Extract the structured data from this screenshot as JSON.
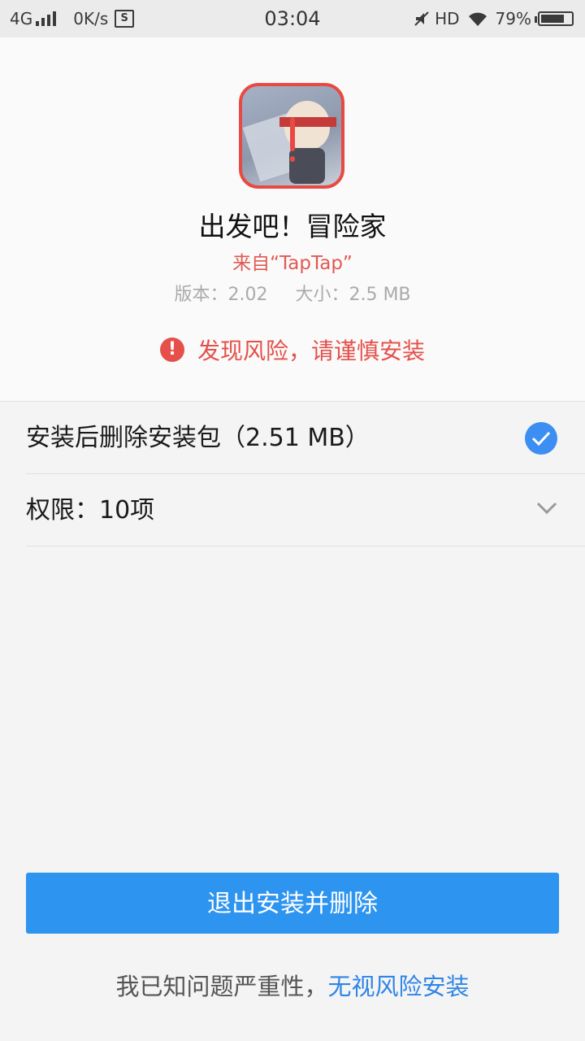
{
  "status_bar": {
    "network": "4G",
    "speed": "0K/s",
    "storage_badge": "S",
    "time": "03:04",
    "hd": "HD",
    "battery": "79%",
    "battery_level": 0.79
  },
  "app": {
    "name": "出发吧！冒险家",
    "source": "来自“TapTap”",
    "version": "版本：2.02",
    "size": "大小：2.5 MB",
    "risk_warning": "发现风险，请谨慎安装"
  },
  "options": {
    "delete_after_install": "安装后删除安装包（2.51 MB）",
    "delete_checked": true,
    "permissions": "权限：10项"
  },
  "actions": {
    "exit_button": "退出安装并删除",
    "footer_text": "我已知问题严重性，",
    "footer_link": "无视风险安装"
  }
}
